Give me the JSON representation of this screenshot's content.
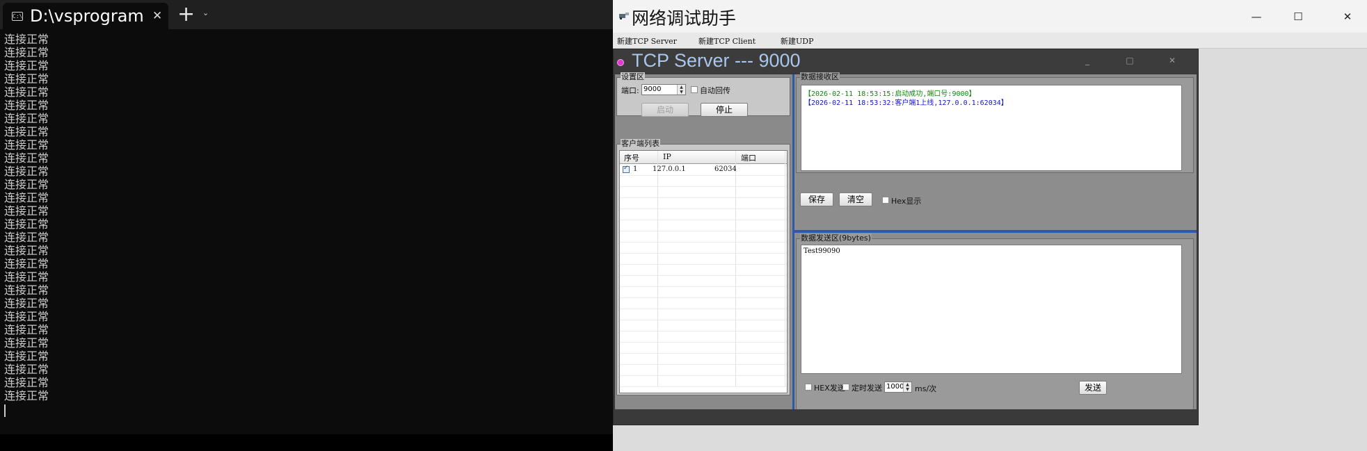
{
  "terminal": {
    "tab_title": "D:\\vsprogram",
    "tab_icon": "terminal-icon",
    "new_tab": "+",
    "dropdown": "⌄",
    "close": "✕",
    "lines": [
      "连接正常",
      "连接正常",
      "连接正常",
      "连接正常",
      "连接正常",
      "连接正常",
      "连接正常",
      "连接正常",
      "连接正常",
      "连接正常",
      "连接正常",
      "连接正常",
      "连接正常",
      "连接正常",
      "连接正常",
      "连接正常",
      "连接正常",
      "连接正常",
      "连接正常",
      "连接正常",
      "连接正常",
      "连接正常",
      "连接正常",
      "连接正常",
      "连接正常",
      "连接正常",
      "连接正常",
      "连接正常"
    ]
  },
  "app": {
    "title": "网络调试助手",
    "min": "—",
    "max": "☐",
    "close": "✕",
    "menu": [
      "新建TCP Server",
      "新建TCP Client",
      "新建UDP"
    ]
  },
  "child": {
    "title": "TCP Server --- 9000",
    "min": "_",
    "max": "□",
    "close": "✕",
    "settings": {
      "group_title": "设置区",
      "port_label": "端口:",
      "port_value": "9000",
      "auto_echo_label": "自动回传",
      "start_label": "启动",
      "stop_label": "停止"
    },
    "clients": {
      "group_title": "客户端列表",
      "headers": [
        "序号",
        "IP",
        "端口"
      ],
      "rows": [
        {
          "no": "1",
          "ip": "127.0.0.1",
          "port": "62034",
          "checked": true
        }
      ]
    },
    "recv": {
      "group_title": "数据接收区",
      "lines": [
        {
          "text": "【2026-02-11 18:53:15:启动成功,端口号:9000】",
          "color": "#0a8a0a"
        },
        {
          "text": "【2026-02-11 18:53:32:客户端1上线,127.0.0.1:62034】",
          "color": "#1414c8"
        }
      ],
      "save_label": "保存",
      "clear_label": "清空",
      "hex_show_label": "Hex显示"
    },
    "send": {
      "group_title": "数据发送区(9bytes)",
      "text": "Test99090",
      "hex_send_label": "HEX发送",
      "timer_send_label": "定时发送",
      "interval_value": "1000",
      "interval_unit": "ms/次",
      "send_label": "发送"
    }
  }
}
